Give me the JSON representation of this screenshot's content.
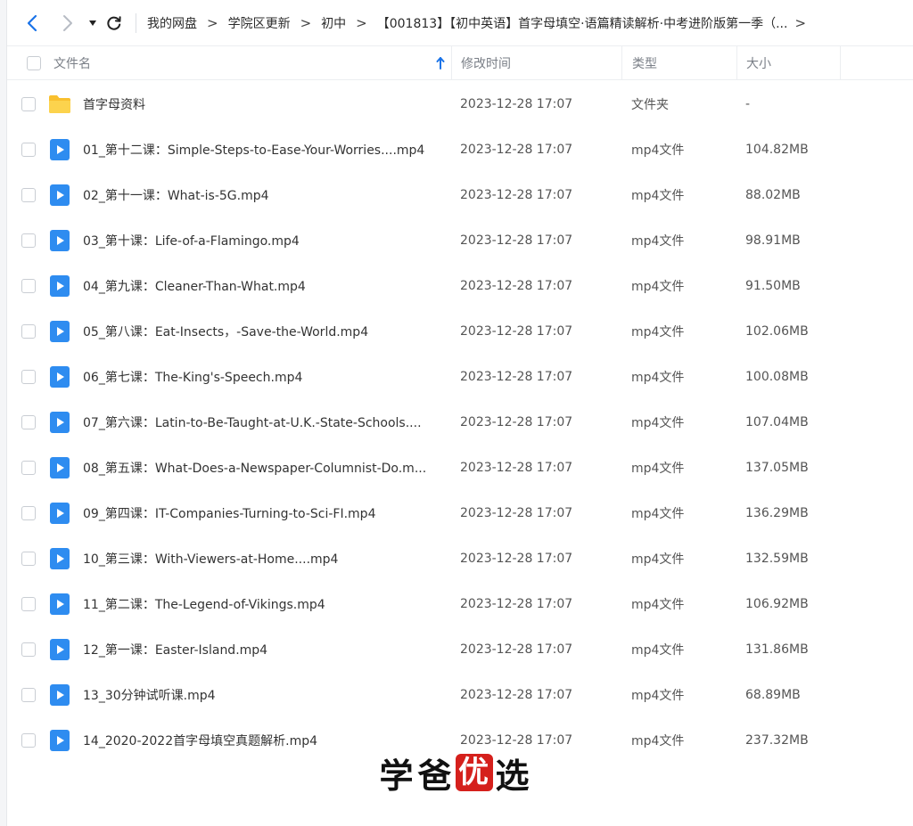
{
  "colors": {
    "accent": "#1a73e8",
    "folder": "#f9c02e",
    "video": "#2e8cf0",
    "watermark_red": "#d5201c"
  },
  "nav": {
    "back_icon": "chevron-left-icon",
    "forward_icon": "chevron-right-icon",
    "dropdown_icon": "caret-down-icon",
    "refresh_icon": "refresh-icon"
  },
  "breadcrumb": {
    "items": [
      "我的网盘",
      "学院区更新",
      "初中",
      "【001813】【初中英语】首字母填空·语篇精读解析·中考进阶版第一季（..."
    ],
    "separator": ">",
    "more": ">"
  },
  "table": {
    "headers": {
      "name": "文件名",
      "modified": "修改时间",
      "type": "类型",
      "size": "大小"
    },
    "sort_icon": "sort-ascending-arrow-icon",
    "rows": [
      {
        "name": "首字母资料",
        "modified": "2023-12-28 17:07",
        "type": "文件夹",
        "size": "-",
        "icon": "folder-icon"
      },
      {
        "name": "01_第十二课：Simple-Steps-to-Ease-Your-Worries....mp4",
        "modified": "2023-12-28 17:07",
        "type": "mp4文件",
        "size": "104.82MB",
        "icon": "video-file-icon"
      },
      {
        "name": "02_第十一课：What-is-5G.mp4",
        "modified": "2023-12-28 17:07",
        "type": "mp4文件",
        "size": "88.02MB",
        "icon": "video-file-icon"
      },
      {
        "name": "03_第十课：Life-of-a-Flamingo.mp4",
        "modified": "2023-12-28 17:07",
        "type": "mp4文件",
        "size": "98.91MB",
        "icon": "video-file-icon"
      },
      {
        "name": "04_第九课：Cleaner-Than-What.mp4",
        "modified": "2023-12-28 17:07",
        "type": "mp4文件",
        "size": "91.50MB",
        "icon": "video-file-icon"
      },
      {
        "name": "05_第八课：Eat-Insects，-Save-the-World.mp4",
        "modified": "2023-12-28 17:07",
        "type": "mp4文件",
        "size": "102.06MB",
        "icon": "video-file-icon"
      },
      {
        "name": "06_第七课：The-King's-Speech.mp4",
        "modified": "2023-12-28 17:07",
        "type": "mp4文件",
        "size": "100.08MB",
        "icon": "video-file-icon"
      },
      {
        "name": "07_第六课：Latin-to-Be-Taught-at-U.K.-State-Schools....",
        "modified": "2023-12-28 17:07",
        "type": "mp4文件",
        "size": "107.04MB",
        "icon": "video-file-icon"
      },
      {
        "name": "08_第五课：What-Does-a-Newspaper-Columnist-Do.m...",
        "modified": "2023-12-28 17:07",
        "type": "mp4文件",
        "size": "137.05MB",
        "icon": "video-file-icon"
      },
      {
        "name": "09_第四课：IT-Companies-Turning-to-Sci-FI.mp4",
        "modified": "2023-12-28 17:07",
        "type": "mp4文件",
        "size": "136.29MB",
        "icon": "video-file-icon"
      },
      {
        "name": "10_第三课：With-Viewers-at-Home....mp4",
        "modified": "2023-12-28 17:07",
        "type": "mp4文件",
        "size": "132.59MB",
        "icon": "video-file-icon"
      },
      {
        "name": "11_第二课：The-Legend-of-Vikings.mp4",
        "modified": "2023-12-28 17:07",
        "type": "mp4文件",
        "size": "106.92MB",
        "icon": "video-file-icon"
      },
      {
        "name": "12_第一课：Easter-Island.mp4",
        "modified": "2023-12-28 17:07",
        "type": "mp4文件",
        "size": "131.86MB",
        "icon": "video-file-icon"
      },
      {
        "name": "13_30分钟试听课.mp4",
        "modified": "2023-12-28 17:07",
        "type": "mp4文件",
        "size": "68.89MB",
        "icon": "video-file-icon"
      },
      {
        "name": "14_2020-2022首字母填空真题解析.mp4",
        "modified": "2023-12-28 17:07",
        "type": "mp4文件",
        "size": "237.32MB",
        "icon": "video-file-icon"
      }
    ]
  },
  "watermark": {
    "chars": [
      "学",
      "爸",
      "优",
      "选"
    ]
  }
}
